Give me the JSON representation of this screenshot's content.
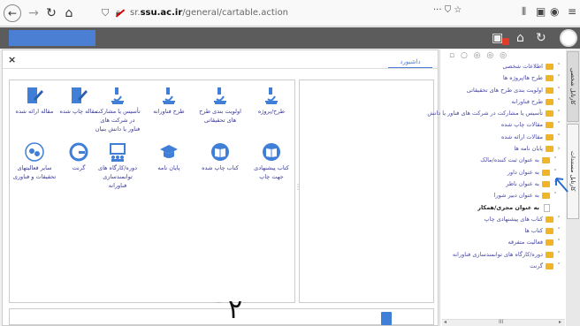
{
  "browser": {
    "url_prefix": "sr.",
    "url_host": "ssu.ac.ir",
    "url_path": "/general/cartable.action",
    "more_icon": "···",
    "icons": [
      "back-icon",
      "forward-icon",
      "reload-icon",
      "home-icon",
      "shield-icon",
      "lock-icon",
      "bookmark-icon",
      "star-icon",
      "library-icon",
      "sidebar-icon",
      "account-icon",
      "menu-icon"
    ]
  },
  "header": {
    "accent_color": "#4a7fd4",
    "badge_color": "#e23b2a"
  },
  "vtabs": {
    "personal": "کارتابل شخصی",
    "docs": "کارتابل مستندات"
  },
  "main": {
    "close_label": "×",
    "tab_dashboard": "داشبورد",
    "grid": [
      {
        "label": "طرح/پروژه",
        "icon": "microscope-icon"
      },
      {
        "label": "اولویت بندی طرح های تحقیقاتی",
        "icon": "microscope-icon"
      },
      {
        "label": "طرح فناورانه",
        "icon": "microscope-icon"
      },
      {
        "label": "تأسیس یا مشارکت در شرکت های فناور یا دانش بنیان",
        "icon": "microscope-icon"
      },
      {
        "label": "مقاله چاپ شده",
        "icon": "edit-doc-icon"
      },
      {
        "label": "مقاله ارائه شده",
        "icon": "edit-doc-icon"
      },
      {
        "label": "کتاب پیشنهادی جهت چاپ",
        "icon": "book-icon"
      },
      {
        "label": "کتاب چاپ شده",
        "icon": "book-icon"
      },
      {
        "label": "پایان نامه",
        "icon": "graduation-cap-icon"
      },
      {
        "label": "دوره/کارگاه های توانمندسازی فناورانه",
        "icon": "workshop-icon"
      },
      {
        "label": "گرنت",
        "icon": "grant-icon"
      },
      {
        "label": "سایر فعالیتهای تحقیقات و فناوری",
        "icon": "activities-icon"
      }
    ],
    "annotation_number": "۲"
  },
  "sidebar": {
    "top_icons": "▫ ○ ◎ ◎ ◎",
    "items": [
      {
        "label": "اطلاعات شخصی",
        "type": "folder"
      },
      {
        "label": "طرح ها/پروژه ها",
        "type": "folder"
      },
      {
        "label": "اولویت بندی طرح های تحقیقاتی",
        "type": "folder"
      },
      {
        "label": "طرح فناورانه",
        "type": "folder"
      },
      {
        "label": "تأسیس یا مشارکت در شرکت های فناور یا دانش",
        "type": "folder"
      },
      {
        "label": "مقالات چاپ شده",
        "type": "folder"
      },
      {
        "label": "مقالات ارائه شده",
        "type": "folder"
      },
      {
        "label": "پایان نامه ها",
        "type": "folder-open"
      },
      {
        "label": "به عنوان ثبت کننده/مالک",
        "type": "sub"
      },
      {
        "label": "به عنوان داور",
        "type": "sub"
      },
      {
        "label": "به عنوان ناظر",
        "type": "sub"
      },
      {
        "label": "به عنوان دبیر شورا",
        "type": "sub"
      },
      {
        "label": "به عنوان مجری/همکار",
        "type": "leaf"
      },
      {
        "label": "کتاب های پیشنهادی چاپ",
        "type": "folder"
      },
      {
        "label": "کتاب ها",
        "type": "folder"
      },
      {
        "label": "فعالیت متفرقه",
        "type": "folder"
      },
      {
        "label": "دوره/کارگاه های توانمندسازی فناورانه",
        "type": "folder"
      },
      {
        "label": "گرنت",
        "type": "folder"
      }
    ],
    "scroll_label": "III"
  }
}
